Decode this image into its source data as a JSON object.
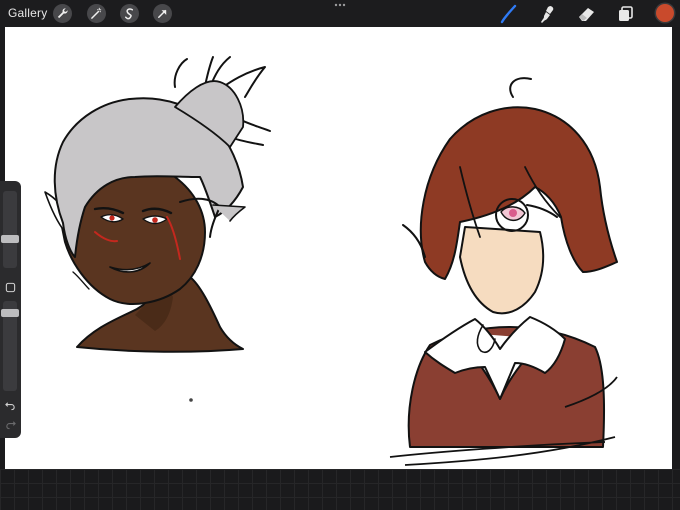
{
  "topbar": {
    "gallery_label": "Gallery",
    "left_tools": [
      {
        "icon": "wrench-icon"
      },
      {
        "icon": "magic-wand-icon"
      },
      {
        "icon": "selection-icon"
      },
      {
        "icon": "transform-arrow-icon"
      }
    ],
    "right_tools": [
      {
        "icon": "brush-icon",
        "color": "#2f7bf6"
      },
      {
        "icon": "smudge-icon",
        "color": "#e8e8e8"
      },
      {
        "icon": "eraser-icon",
        "color": "#e8e8e8"
      },
      {
        "icon": "layers-icon",
        "color": "#e8e8e8"
      }
    ],
    "current_color": "#c94a2c"
  },
  "sidebar": {
    "brush_size_level": 0.5,
    "opacity_level": 0.6,
    "icons": [
      "square-modify-icon",
      "undo-icon",
      "redo-icon"
    ]
  },
  "colors": {
    "skin_dark": "#5a3520",
    "hair_silver": "#c8c6c8",
    "hair_red": "#8e3a24",
    "skin_light": "#f6dcc0",
    "vest": "#8a3f32",
    "accent_red": "#c4281e"
  }
}
